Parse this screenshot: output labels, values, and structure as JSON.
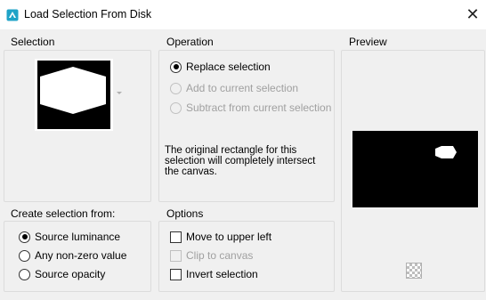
{
  "window": {
    "title": "Load Selection From Disk",
    "close_glyph": "✕",
    "icon": "selection-app-icon"
  },
  "selection_group": {
    "label": "Selection",
    "thumbnail_icon": "selection-thumbnail"
  },
  "operation_group": {
    "label": "Operation",
    "options": [
      {
        "label": "Replace selection",
        "selected": true,
        "enabled": true
      },
      {
        "label": "Add to current selection",
        "selected": false,
        "enabled": false
      },
      {
        "label": "Subtract from current selection",
        "selected": false,
        "enabled": false
      }
    ],
    "info": "The original rectangle for this selection will completely intersect the canvas."
  },
  "preview_group": {
    "label": "Preview",
    "checker_icon": "transparency-checker-icon"
  },
  "create_group": {
    "label": "Create selection from:",
    "options": [
      {
        "label": "Source luminance",
        "selected": true
      },
      {
        "label": "Any non-zero value",
        "selected": false
      },
      {
        "label": "Source opacity",
        "selected": false
      }
    ]
  },
  "options_group": {
    "label": "Options",
    "items": [
      {
        "label": "Move to upper left",
        "checked": false,
        "enabled": true
      },
      {
        "label": "Clip to canvas",
        "checked": false,
        "enabled": false
      },
      {
        "label": "Invert selection",
        "checked": false,
        "enabled": true
      }
    ]
  },
  "colors": {
    "background": "#f0f0f0",
    "titlebar": "#ffffff",
    "accent": "#1fa3c7",
    "disabled_text": "#a0a0a0"
  }
}
